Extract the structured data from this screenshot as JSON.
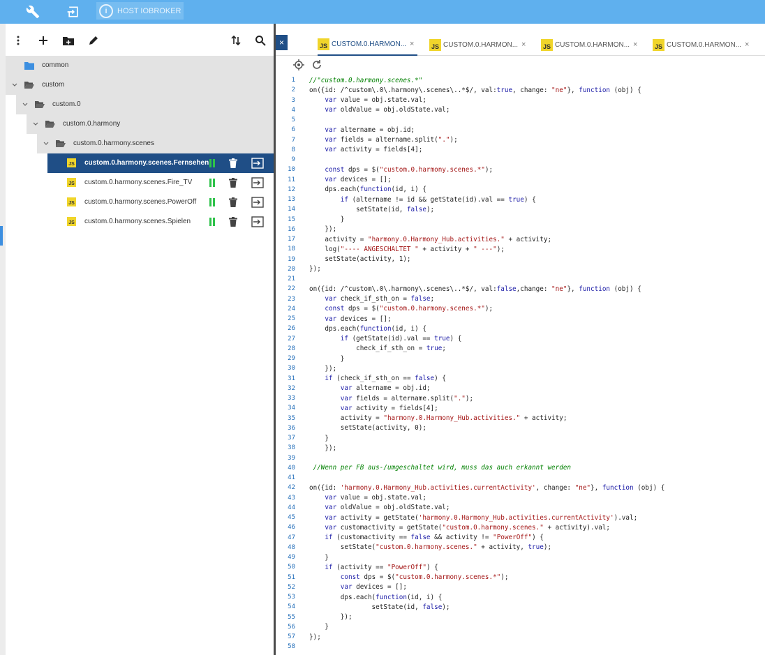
{
  "topbar": {
    "host_label": "HOST IOBROKER"
  },
  "tree": {
    "rows": [
      {
        "label": "common",
        "kind": "folder-closed",
        "level": 0,
        "expanded": false
      },
      {
        "label": "custom",
        "kind": "folder-open",
        "level": 0,
        "expanded": true
      },
      {
        "label": "custom.0",
        "kind": "folder-open",
        "level": 1,
        "expanded": true
      },
      {
        "label": "custom.0.harmony",
        "kind": "folder-open",
        "level": 2,
        "expanded": true
      },
      {
        "label": "custom.0.harmony.scenes",
        "kind": "folder-open",
        "level": 3,
        "expanded": true
      },
      {
        "label": "custom.0.harmony.scenes.Fernsehen",
        "kind": "script",
        "level": 4,
        "selected": true
      },
      {
        "label": "custom.0.harmony.scenes.Fire_TV",
        "kind": "script",
        "level": 4,
        "selected": false
      },
      {
        "label": "custom.0.harmony.scenes.PowerOff",
        "kind": "script",
        "level": 4,
        "selected": false
      },
      {
        "label": "custom.0.harmony.scenes.Spielen",
        "kind": "script",
        "level": 4,
        "selected": false
      }
    ],
    "js_badge": "JS"
  },
  "tabs": [
    {
      "label": "CUSTOM.0.HARMON...",
      "active": true
    },
    {
      "label": "CUSTOM.0.HARMON...",
      "active": false
    },
    {
      "label": "CUSTOM.0.HARMON...",
      "active": false
    },
    {
      "label": "CUSTOM.0.HARMON...",
      "active": false
    }
  ],
  "tab_js_badge": "JS",
  "tab_close_glyph": "×",
  "code_lines": [
    "//\"custom.0.harmony.scenes.*\"",
    "on({id: /^custom\\.0\\.harmony\\.scenes\\..*$/, val:true, change: \"ne\"}, function (obj) {",
    "    var value = obj.state.val;",
    "    var oldValue = obj.oldState.val;",
    "",
    "    var altername = obj.id;",
    "    var fields = altername.split(\".\");",
    "    var activity = fields[4];",
    "",
    "    const dps = $(\"custom.0.harmony.scenes.*\");",
    "    var devices = [];",
    "    dps.each(function(id, i) {",
    "        if (altername != id && getState(id).val == true) {",
    "            setState(id, false);",
    "        }",
    "    });",
    "    activity = \"harmony.0.Harmony_Hub.activities.\" + activity;",
    "    log(\"---- ANGESCHALTET \" + activity + \" ---\");",
    "    setState(activity, 1);",
    "});",
    "",
    "on({id: /^custom\\.0\\.harmony\\.scenes\\..*$/, val:false,change: \"ne\"}, function (obj) {",
    "    var check_if_sth_on = false;",
    "    const dps = $(\"custom.0.harmony.scenes.*\");",
    "    var devices = [];",
    "    dps.each(function(id, i) {",
    "        if (getState(id).val == true) {",
    "            check_if_sth_on = true;",
    "        }",
    "    });",
    "    if (check_if_sth_on == false) {",
    "        var altername = obj.id;",
    "        var fields = altername.split(\".\");",
    "        var activity = fields[4];",
    "        activity = \"harmony.0.Harmony_Hub.activities.\" + activity;",
    "        setState(activity, 0);",
    "    }",
    "    });",
    "",
    " //Wenn per FB aus-/umgeschaltet wird, muss das auch erkannt werden",
    "",
    "on({id: 'harmony.0.Harmony_Hub.activities.currentActivity', change: \"ne\"}, function (obj) {",
    "    var value = obj.state.val;",
    "    var oldValue = obj.oldState.val;",
    "    var activity = getState('harmony.0.Harmony_Hub.activities.currentActivity').val;",
    "    var customactivity = getState(\"custom.0.harmony.scenes.\" + activity).val;",
    "    if (customactivity == false && activity != \"PowerOff\") {",
    "        setState(\"custom.0.harmony.scenes.\" + activity, true);",
    "    }",
    "    if (activity == \"PowerOff\") {",
    "        const dps = $(\"custom.0.harmony.scenes.*\");",
    "        var devices = [];",
    "        dps.each(function(id, i) {",
    "                setState(id, false);",
    "        });",
    "    }",
    "});",
    ""
  ],
  "colors": {
    "topbar": "#5fb0ee",
    "selected_row": "#1f4e86",
    "keyword": "#1a1aa6",
    "string": "#a31515",
    "comment": "#008000",
    "line_number": "#1e6bb8",
    "play_green": "#2ec24a"
  }
}
